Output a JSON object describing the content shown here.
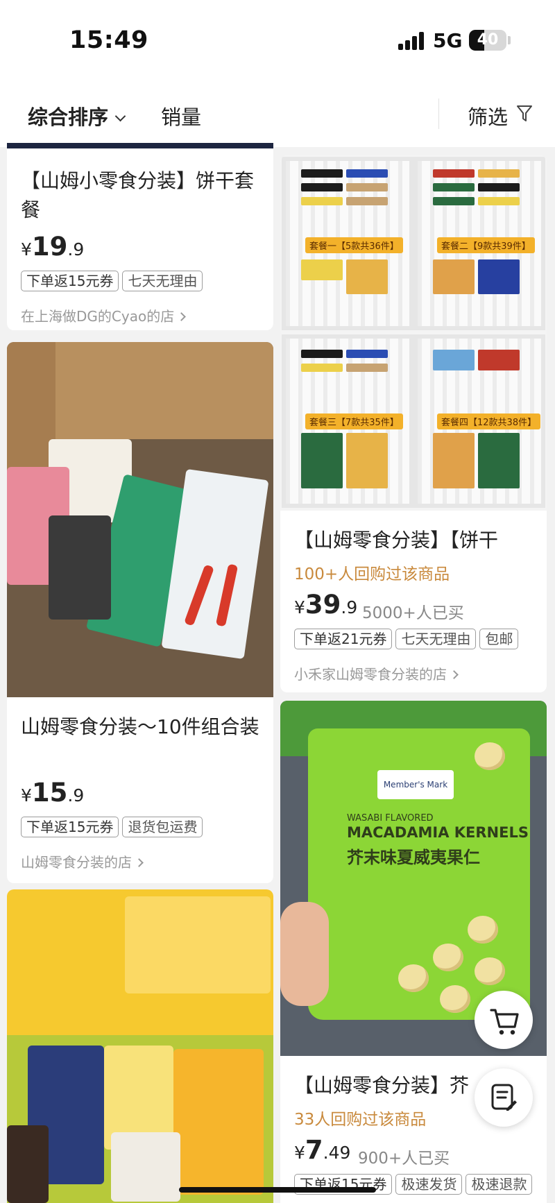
{
  "status": {
    "time": "15:49",
    "network": "5G",
    "battery": "40",
    "battery_level": 0.4
  },
  "sortbar": {
    "sort_label": "综合排序",
    "sales_label": "销量",
    "filter_label": "筛选"
  },
  "left": [
    {
      "title": "【山姆小零食分装】饼干套餐",
      "price_int": "19",
      "price_dec": ".9",
      "tags": [
        "下单返15元券",
        "七天无理由"
      ],
      "shop": "在上海做DG的Cyao的店"
    },
    {
      "title": "山姆零食分装～10件组合装",
      "price_int": "15",
      "price_dec": ".9",
      "tags": [
        "下单返15元券",
        "退货包运费"
      ],
      "shop": "山姆零食分装的店"
    }
  ],
  "right": [
    {
      "title": "【山姆零食分装】【饼干",
      "repeat": "100+人回购过该商品",
      "price_int": "39",
      "price_dec": ".9",
      "sold": "5000+人已买",
      "tags": [
        "下单返21元券",
        "七天无理由",
        "包邮"
      ],
      "shop": "小禾家山姆零食分装的店",
      "image_labels": [
        "套餐一【5款共36件】",
        "套餐二【9款共39件】",
        "套餐三【7款共35件】",
        "套餐四【12款共38件】"
      ]
    },
    {
      "title": "【山姆零食分装】芥",
      "repeat": "33人回购过该商品",
      "price_int": "7",
      "price_dec": ".49",
      "sold": "900+人已买",
      "tags": [
        "下单返15元券",
        "极速发货",
        "极速退款"
      ],
      "bag": {
        "brand": "Member's Mark",
        "flavor": "WASABI FLAVORED",
        "name_en": "MACADAMIA KERNELS",
        "name_zh": "芥末味夏威夷果仁"
      }
    }
  ],
  "currency": "¥"
}
